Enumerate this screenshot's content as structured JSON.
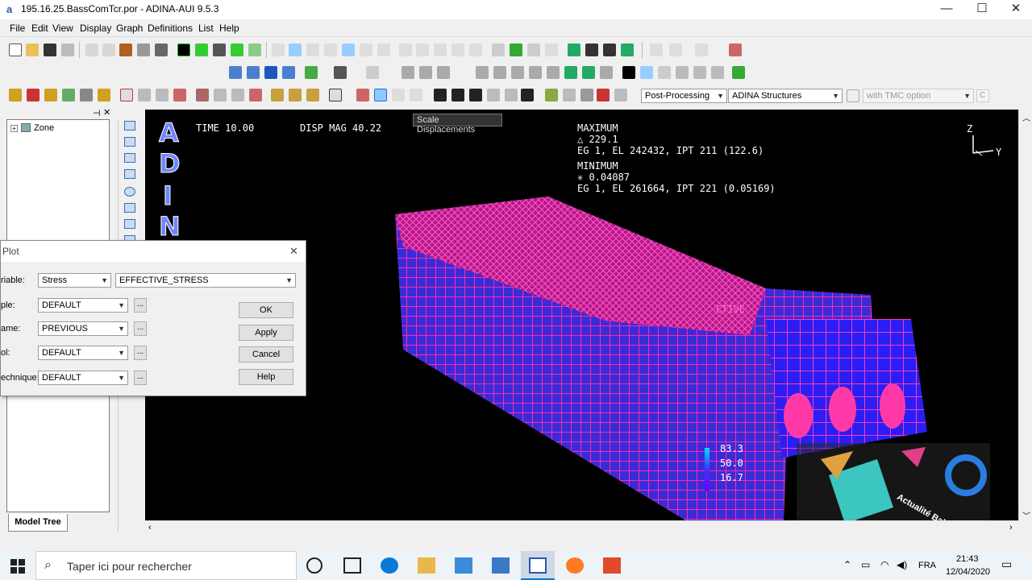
{
  "window": {
    "title": "195.16.25.BassComTcr.por - ADINA-AUI 9.5.3",
    "icon_letter": "a",
    "minimize": "—",
    "maximize": "☐",
    "close": "✕"
  },
  "menu": [
    "File",
    "Edit",
    "View",
    "Display",
    "Graph",
    "Definitions",
    "List",
    "Help"
  ],
  "toolbar3": {
    "mode": "Post-Processing",
    "program": "ADINA Structures",
    "option": "with TMC option",
    "c_label": "C"
  },
  "tooltip": "Scale Displacements",
  "tree": {
    "root": "Zone",
    "tab": "Model Tree"
  },
  "graphics": {
    "time": "TIME 10.00",
    "disp_mag": "DISP MAG 40.22",
    "max_title": "MAXIMUM",
    "max_value": "△ 229.1",
    "max_loc": "EG 1, EL 242432, IPT 211 (122.6)",
    "min_title": "MINIMUM",
    "min_value": "✳ 0.04087",
    "min_loc": "EG 1, EL 261664, IPT 221 (0.05169)",
    "logo": [
      "A",
      "D",
      "I",
      "N"
    ],
    "axis_z": "Z",
    "axis_y": "Y",
    "legend_values": [
      "83.3",
      "50.0",
      "16.7"
    ],
    "partial_label": "CTIVE",
    "watermark": "Actualité Balak"
  },
  "dialog": {
    "title": "Plot",
    "rows": [
      {
        "label": "riable:",
        "value1": "Stress",
        "value2": "EFFECTIVE_STRESS"
      },
      {
        "label": "ple:",
        "value": "DEFAULT"
      },
      {
        "label": "ame:",
        "value": "PREVIOUS"
      },
      {
        "label": "ol:",
        "value": "DEFAULT"
      },
      {
        "label": "echnique:",
        "value": "DEFAULT"
      }
    ],
    "buttons": [
      "OK",
      "Apply",
      "Cancel",
      "Help"
    ],
    "dots": "..."
  },
  "taskbar": {
    "search_placeholder": "Taper ici pour rechercher",
    "lang": "FRA",
    "time": "21:43",
    "date": "12/04/2020"
  },
  "colors": {
    "accent": "#0078d7",
    "mesh_pink": "#ff1493",
    "mesh_blue": "#2020ff",
    "logo_blue": "#6f86ff"
  }
}
